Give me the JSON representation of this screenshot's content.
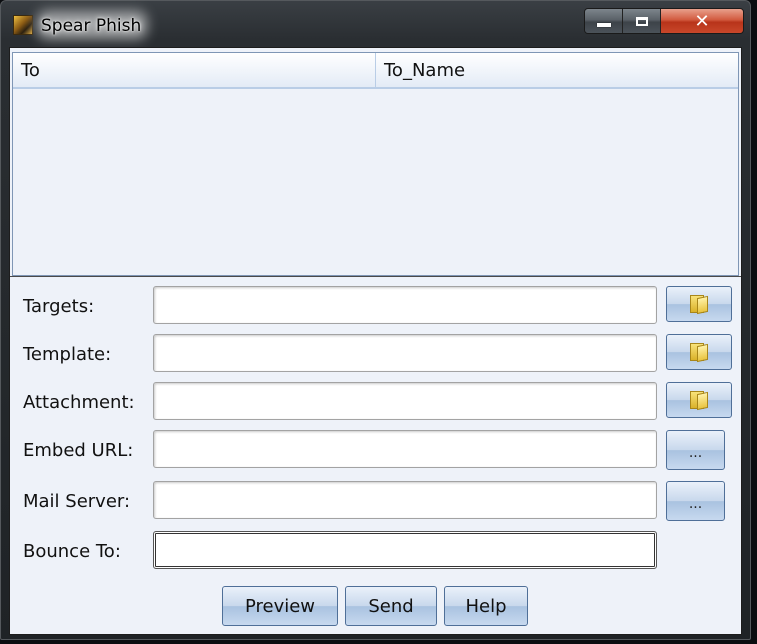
{
  "window": {
    "title": "Spear Phish",
    "icon": "app-icon",
    "caption_buttons": {
      "minimize": "minimize-icon",
      "maximize": "maximize-icon",
      "close_label": "✕"
    }
  },
  "table": {
    "columns": [
      "To",
      "To_Name"
    ],
    "rows": []
  },
  "form": {
    "targets": {
      "label": "Targets:",
      "value": ""
    },
    "template": {
      "label": "Template:",
      "value": ""
    },
    "attachment": {
      "label": "Attachment:",
      "value": ""
    },
    "embed_url": {
      "label": "Embed URL:",
      "value": ""
    },
    "mail_server": {
      "label": "Mail Server:",
      "value": ""
    },
    "bounce_to": {
      "label": "Bounce To:",
      "value": ""
    },
    "browse_icon": "folder-icon",
    "dots_label": "..."
  },
  "actions": {
    "preview": "Preview",
    "send": "Send",
    "help": "Help"
  }
}
